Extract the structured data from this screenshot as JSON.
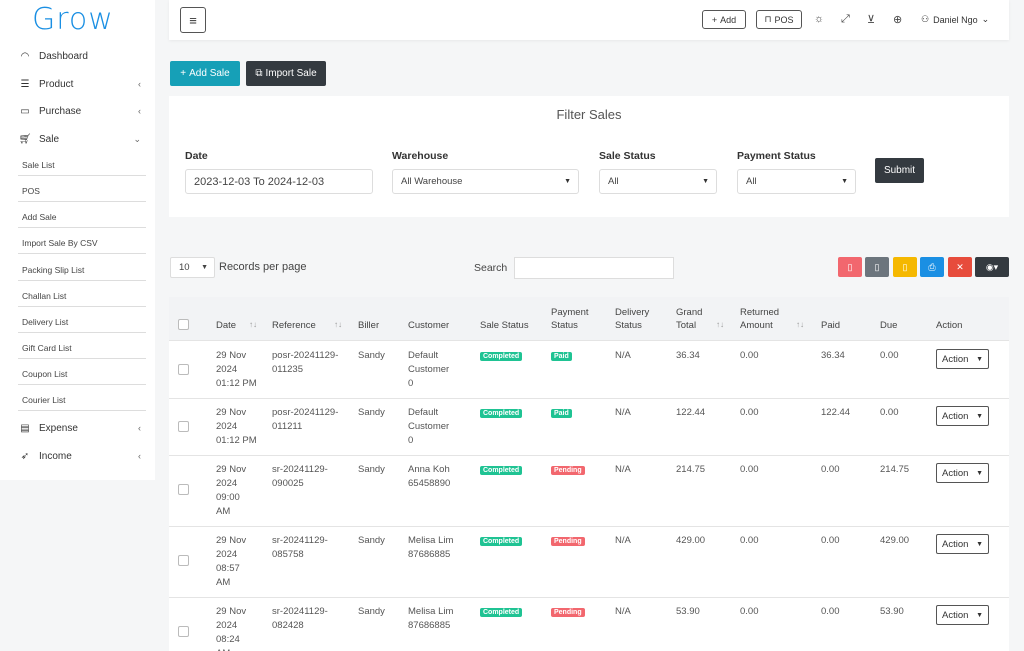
{
  "brand": {
    "logo": "Grow"
  },
  "sidebar": {
    "items": [
      {
        "label": "Dashboard",
        "icon": "speedometer-icon"
      },
      {
        "label": "Product",
        "icon": "list-icon"
      },
      {
        "label": "Purchase",
        "icon": "card-icon"
      },
      {
        "label": "Sale",
        "icon": "cart-icon"
      },
      {
        "label": "Expense",
        "icon": "wallet-icon"
      },
      {
        "label": "Income",
        "icon": "rocket-icon"
      }
    ],
    "sale_sub": [
      "Sale List",
      "POS",
      "Add Sale",
      "Import Sale By CSV",
      "Packing Slip List",
      "Challan List",
      "Delivery List",
      "Gift Card List",
      "Coupon List",
      "Courier List"
    ]
  },
  "topbar": {
    "add_label": "Add",
    "pos_label": "POS",
    "user_name": "Daniel Ngo"
  },
  "actions": {
    "add_sale": "Add Sale",
    "import_sale": "Import Sale"
  },
  "filter": {
    "title": "Filter Sales",
    "date_label": "Date",
    "date_value": "2023-12-03 To 2024-12-03",
    "warehouse_label": "Warehouse",
    "warehouse_value": "All Warehouse",
    "sale_status_label": "Sale Status",
    "sale_status_value": "All",
    "payment_status_label": "Payment Status",
    "payment_status_value": "All",
    "submit": "Submit"
  },
  "list": {
    "records_value": "10",
    "records_label": "Records per page",
    "search_label": "Search"
  },
  "export_colors": {
    "pdf": "#f2676e",
    "csv": "#6c757d",
    "excel": "#f5b800",
    "print": "#1a8fe3",
    "delete": "#e74c3c",
    "columns": "#343a40"
  },
  "table": {
    "headers": {
      "date": "Date",
      "reference": "Reference",
      "biller": "Biller",
      "customer": "Customer",
      "sale_status": "Sale Status",
      "payment_status": [
        "Payment",
        "Status"
      ],
      "delivery_status": [
        "Delivery",
        "Status"
      ],
      "grand_total": [
        "Grand",
        "Total"
      ],
      "returned_amount": [
        "Returned",
        "Amount"
      ],
      "paid": "Paid",
      "due": "Due",
      "action": "Action"
    },
    "rows": [
      {
        "date": [
          "29 Nov",
          "2024",
          "01:12 PM"
        ],
        "reference": [
          "posr-20241129-",
          "011235"
        ],
        "biller": "Sandy",
        "customer": [
          "Default",
          "Customer",
          "0"
        ],
        "sale_status": "Completed",
        "payment_status": "Paid",
        "delivery": "N/A",
        "grand_total": "36.34",
        "returned": "0.00",
        "paid": "36.34",
        "due": "0.00",
        "action": "Action"
      },
      {
        "date": [
          "29 Nov",
          "2024",
          "01:12 PM"
        ],
        "reference": [
          "posr-20241129-",
          "011211"
        ],
        "biller": "Sandy",
        "customer": [
          "Default",
          "Customer",
          "0"
        ],
        "sale_status": "Completed",
        "payment_status": "Paid",
        "delivery": "N/A",
        "grand_total": "122.44",
        "returned": "0.00",
        "paid": "122.44",
        "due": "0.00",
        "action": "Action"
      },
      {
        "date": [
          "29 Nov",
          "2024",
          "09:00",
          "AM"
        ],
        "reference": [
          "sr-20241129-",
          "090025"
        ],
        "biller": "Sandy",
        "customer": [
          "Anna Koh",
          "65458890"
        ],
        "sale_status": "Completed",
        "payment_status": "Pending",
        "delivery": "N/A",
        "grand_total": "214.75",
        "returned": "0.00",
        "paid": "0.00",
        "due": "214.75",
        "action": "Action"
      },
      {
        "date": [
          "29 Nov",
          "2024",
          "08:57",
          "AM"
        ],
        "reference": [
          "sr-20241129-",
          "085758"
        ],
        "biller": "Sandy",
        "customer": [
          "Melisa Lim",
          "87686885"
        ],
        "sale_status": "Completed",
        "payment_status": "Pending",
        "delivery": "N/A",
        "grand_total": "429.00",
        "returned": "0.00",
        "paid": "0.00",
        "due": "429.00",
        "action": "Action"
      },
      {
        "date": [
          "29 Nov",
          "2024",
          "08:24",
          "AM"
        ],
        "reference": [
          "sr-20241129-",
          "082428"
        ],
        "biller": "Sandy",
        "customer": [
          "Melisa Lim",
          "87686885"
        ],
        "sale_status": "Completed",
        "payment_status": "Pending",
        "delivery": "N/A",
        "grand_total": "53.90",
        "returned": "0.00",
        "paid": "0.00",
        "due": "53.90",
        "action": "Action"
      }
    ]
  }
}
